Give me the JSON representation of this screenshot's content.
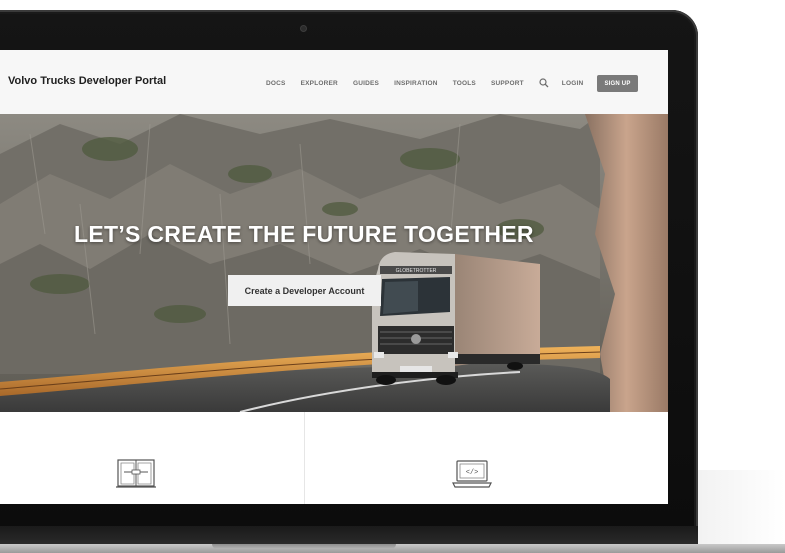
{
  "header": {
    "brand": "Volvo Trucks Developer Portal",
    "nav": [
      "DOCS",
      "EXPLORER",
      "GUIDES",
      "INSPIRATION",
      "TOOLS",
      "SUPPORT"
    ],
    "login": "LOGIN",
    "signup": "SIGN UP"
  },
  "hero": {
    "title": "LET’S CREATE THE FUTURE TOGETHER",
    "cta": "Create a Developer Account",
    "truck_text": "GLOBETROTTER"
  },
  "features": {
    "icons": [
      "book-icon",
      "code-laptop-icon"
    ]
  },
  "colors": {
    "header_bg": "#f7f7f7",
    "signup_bg": "#7a7a7a",
    "cta_bg": "#f0f0f0",
    "nav_text": "#6d6d6d"
  }
}
